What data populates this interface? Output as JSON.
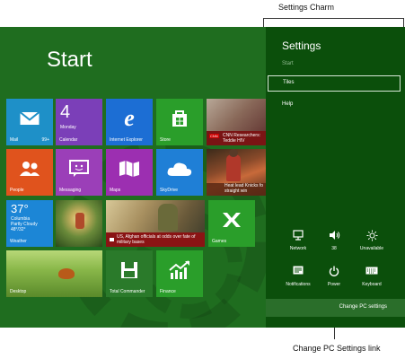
{
  "callouts": {
    "settings_charm": "Settings Charm",
    "change_pc_settings_link": "Change PC Settings link"
  },
  "start_screen": {
    "title": "Start",
    "tiles": {
      "mail": {
        "label": "Mail",
        "badge": "99+",
        "icon": "envelope-icon",
        "color": "#1e90c8"
      },
      "calendar": {
        "label": "Calendar",
        "day_number": "4",
        "day_name": "Monday",
        "color": "#7b3fb8"
      },
      "internet_explorer": {
        "label": "Internet Explorer",
        "icon": "ie-e-icon",
        "color": "#1c6ed4"
      },
      "store": {
        "label": "Store",
        "icon": "store-bag-icon",
        "color": "#2a9e2a"
      },
      "news": {
        "label": "CNN Researchers: Teddie HIV",
        "color": "#8b1a1a"
      },
      "people": {
        "label": "People",
        "icon": "people-icon",
        "color": "#e0531d"
      },
      "messaging": {
        "label": "Messaging",
        "icon": "chat-bubble-icon",
        "color": "#9b3fb8"
      },
      "maps": {
        "label": "Maps",
        "icon": "map-icon",
        "color": "#9c2fb1"
      },
      "skydrive": {
        "label": "SkyDrive",
        "icon": "cloud-icon",
        "color": "#1f7fd6"
      },
      "sports": {
        "label": "Heat lead Knicks fo straight win",
        "color": "#6e4426"
      },
      "weather": {
        "temp": "37°",
        "city": "Columbia",
        "condition": "Partly Cloudy",
        "range": "48°/32°",
        "label": "Weather",
        "color": "#1c86d6"
      },
      "photos": {
        "label": "",
        "color": "#6a8a3a"
      },
      "news_big": {
        "label": "US, Afghan officials at odds over fate of military bases",
        "color": "#7a6a3a"
      },
      "games": {
        "label": "Games",
        "icon": "xbox-controller-icon",
        "color": "#2a9e2a"
      },
      "desktop": {
        "label": "Desktop",
        "color": "#6a9a3a"
      },
      "total_commander": {
        "label": "Total Commander",
        "icon": "floppy-disk-icon",
        "color": "#2a7a2a"
      },
      "finance": {
        "label": "Finance",
        "icon": "chart-up-icon",
        "color": "#2a9e2a"
      }
    }
  },
  "settings_panel": {
    "title": "Settings",
    "start_label": "Start",
    "tiles_label": "Tiles",
    "help_label": "Help",
    "quick_settings": [
      {
        "label": "Network",
        "icon": "network-icon"
      },
      {
        "label": "38",
        "icon": "volume-icon"
      },
      {
        "label": "Unavailable",
        "icon": "brightness-icon"
      },
      {
        "label": "Notifications",
        "icon": "notifications-icon"
      },
      {
        "label": "Power",
        "icon": "power-icon"
      },
      {
        "label": "Keyboard",
        "icon": "keyboard-icon"
      }
    ],
    "change_pc_settings": "Change PC settings"
  }
}
